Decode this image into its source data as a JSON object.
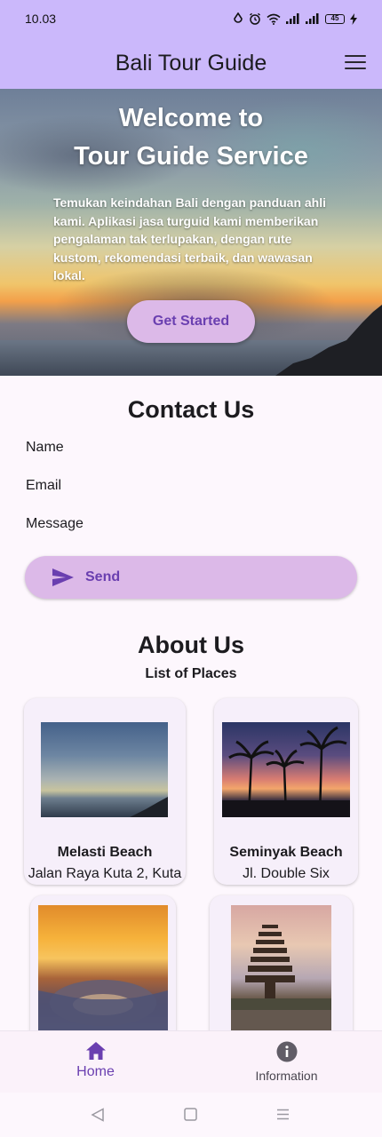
{
  "status_bar": {
    "time": "10.03",
    "battery": "45"
  },
  "app_bar": {
    "title": "Bali Tour Guide",
    "menu_icon": "menu-icon"
  },
  "hero": {
    "title_line1": "Welcome to",
    "title_line2": "Tour Guide Service",
    "description": "Temukan keindahan Bali dengan panduan ahli kami. Aplikasi jasa turguid kami memberikan pengalaman tak terlupakan, dengan rute kustom, rekomendasi terbaik, dan wawasan lokal.",
    "cta_label": "Get Started"
  },
  "contact": {
    "title": "Contact Us",
    "fields": {
      "name": "Name",
      "email": "Email",
      "message": "Message"
    },
    "send_label": "Send",
    "send_icon": "send-icon"
  },
  "about": {
    "title": "About Us",
    "subtitle": "List of Places",
    "places": [
      {
        "name": "Melasti Beach",
        "address": "Jalan Raya Kuta 2, Kuta"
      },
      {
        "name": "Seminyak Beach",
        "address": "Jl. Double Six"
      }
    ]
  },
  "bottom_nav": {
    "items": [
      {
        "label": "Home",
        "icon": "home-icon",
        "active": true
      },
      {
        "label": "Information",
        "icon": "info-icon",
        "active": false
      }
    ]
  },
  "colors": {
    "app_bar": "#cbb8fb",
    "button": "#dcb9e8",
    "accent": "#6a3fb0",
    "background": "#fdf7fd"
  }
}
